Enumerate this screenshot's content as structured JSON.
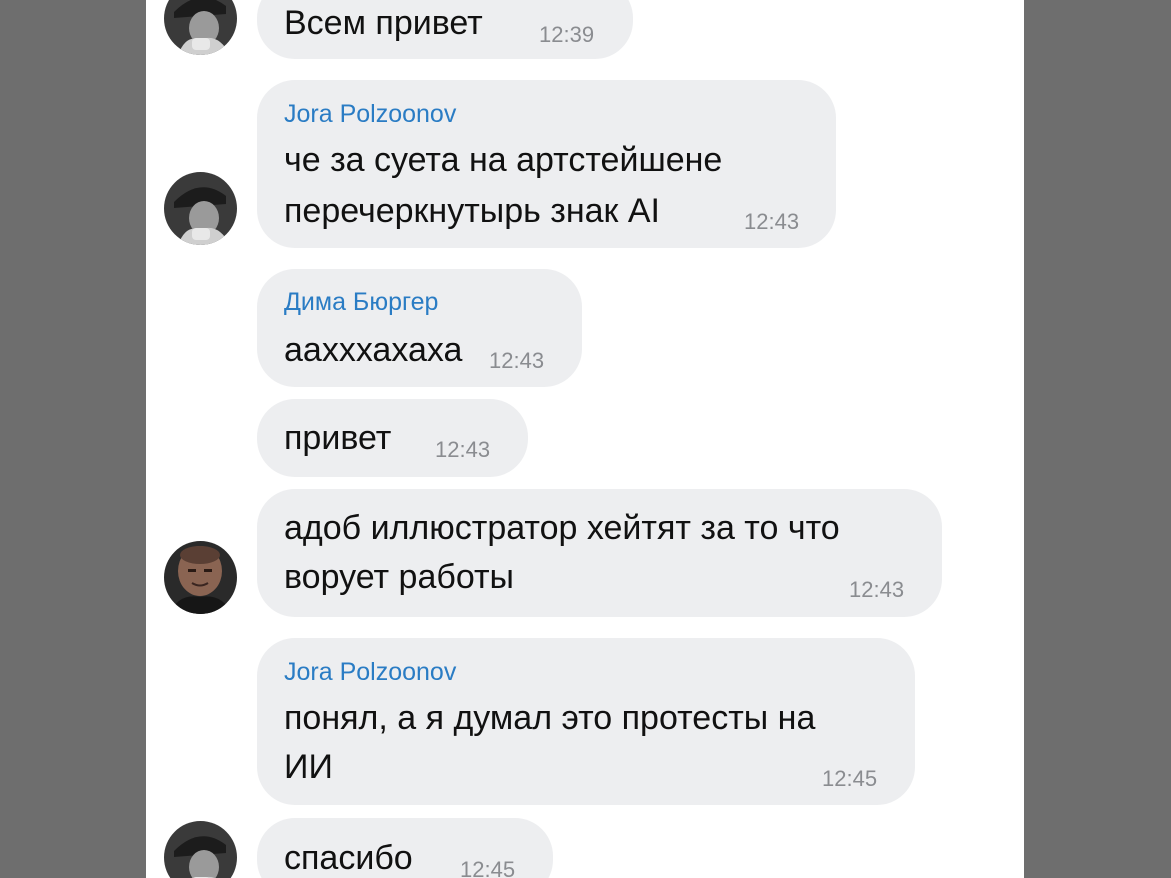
{
  "chat": {
    "messages": [
      {
        "sender": "",
        "lines": [
          "Всем привет"
        ],
        "time": "12:39",
        "avatar": "user-avatar-jora"
      },
      {
        "sender": "Jora Polzoonov",
        "lines": [
          "че за суета на артстейшене",
          "перечеркнутырь знак AI"
        ],
        "time": "12:43",
        "avatar": "user-avatar-jora"
      },
      {
        "sender": "Дима Бюргер",
        "lines": [
          "аахххахаха"
        ],
        "time": "12:43",
        "avatar": ""
      },
      {
        "sender": "",
        "lines": [
          "привет"
        ],
        "time": "12:43",
        "avatar": ""
      },
      {
        "sender": "",
        "lines": [
          "адоб иллюстратор хейтят за то что",
          "ворует работы"
        ],
        "time": "12:43",
        "avatar": "user-avatar-dima"
      },
      {
        "sender": "Jora Polzoonov",
        "lines": [
          "понял, а я думал это протесты на",
          "ИИ"
        ],
        "time": "12:45",
        "avatar": ""
      },
      {
        "sender": "",
        "lines": [
          "спасибо"
        ],
        "time": "12:45",
        "avatar": "user-avatar-jora"
      }
    ]
  },
  "colors": {
    "sender_name": "#2a7cc4",
    "bubble_bg": "#edeef0",
    "timestamp": "#8a8c90",
    "side_background": "#6e6e6e"
  }
}
